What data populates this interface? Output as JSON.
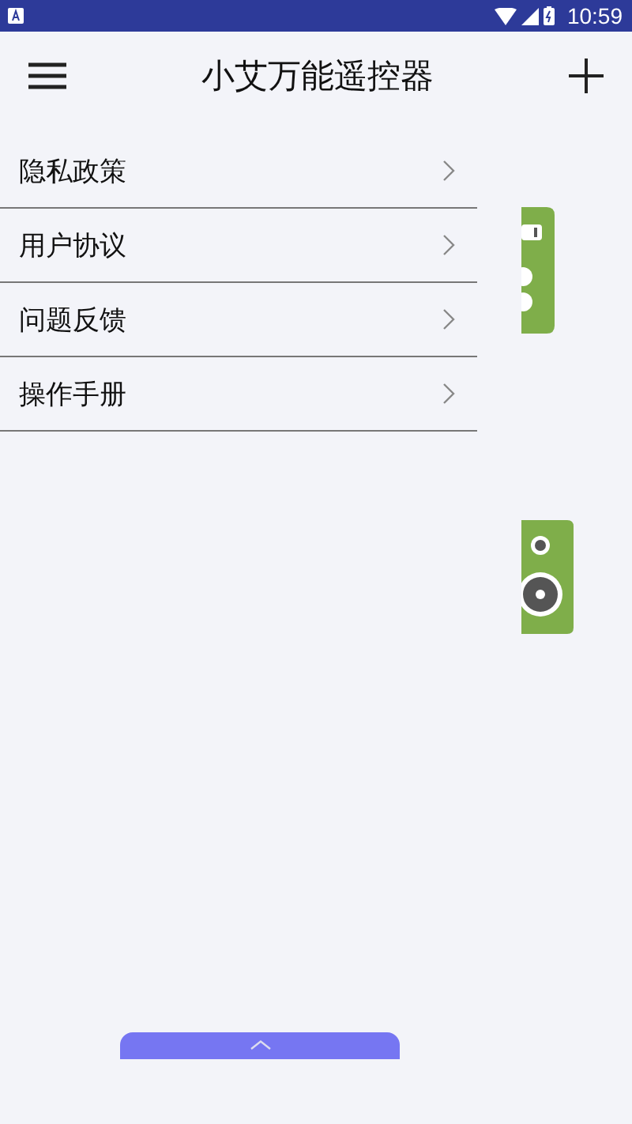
{
  "status_bar": {
    "time": "10:59"
  },
  "header": {
    "title": "小艾万能遥控器"
  },
  "menu": {
    "items": [
      {
        "label": "隐私政策"
      },
      {
        "label": "用户协议"
      },
      {
        "label": "问题反馈"
      },
      {
        "label": "操作手册"
      }
    ]
  }
}
